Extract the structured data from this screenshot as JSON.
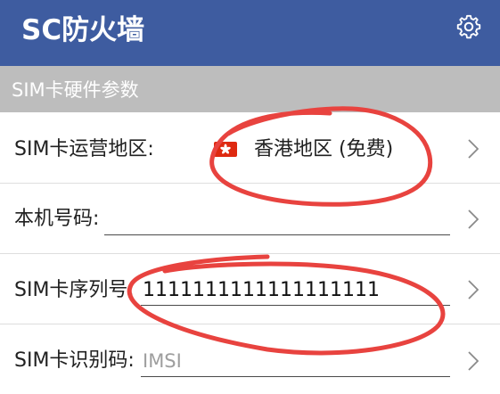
{
  "app_bar": {
    "title": "SC防火墙",
    "settings_icon": "gear-icon",
    "background_color": "#3e5ca0"
  },
  "section": {
    "title": "SIM卡硬件参数",
    "background_color": "#bdbdbd"
  },
  "rows": {
    "region": {
      "label": "SIM卡运营地区:",
      "flag_icon": "hong-kong-flag-icon",
      "value": "香港地区 (免费)"
    },
    "phone_number": {
      "label": "本机号码:",
      "value": ""
    },
    "sim_serial": {
      "label": "SIM卡序列号:",
      "value": "1111111111111111111"
    },
    "sim_id": {
      "label": "SIM卡识别码:",
      "placeholder": "IMSI",
      "value": ""
    }
  },
  "annotation_color": "#e8433f"
}
